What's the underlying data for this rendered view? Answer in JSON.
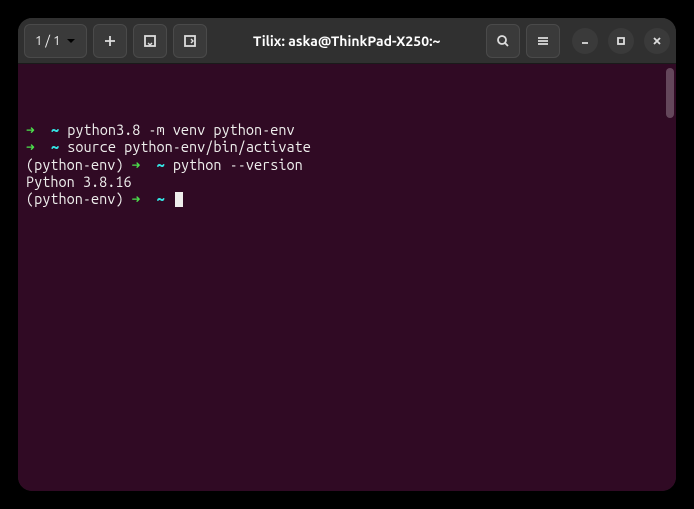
{
  "titlebar": {
    "session_counter": "1 / 1",
    "title": "Tilix: aska@ThinkPad-X250:~"
  },
  "terminal": {
    "lines": [
      {
        "arrow": "➜",
        "tilde": "~",
        "command": "python3.8 -m venv python-env"
      },
      {
        "arrow": "➜",
        "tilde": "~",
        "command": "source python-env/bin/activate"
      },
      {
        "venv": "(python-env)",
        "arrow": "➜",
        "tilde": "~",
        "command": "python --version"
      },
      {
        "output": "Python 3.8.16"
      },
      {
        "venv": "(python-env)",
        "arrow": "➜",
        "tilde": "~",
        "cursor": true
      }
    ]
  }
}
